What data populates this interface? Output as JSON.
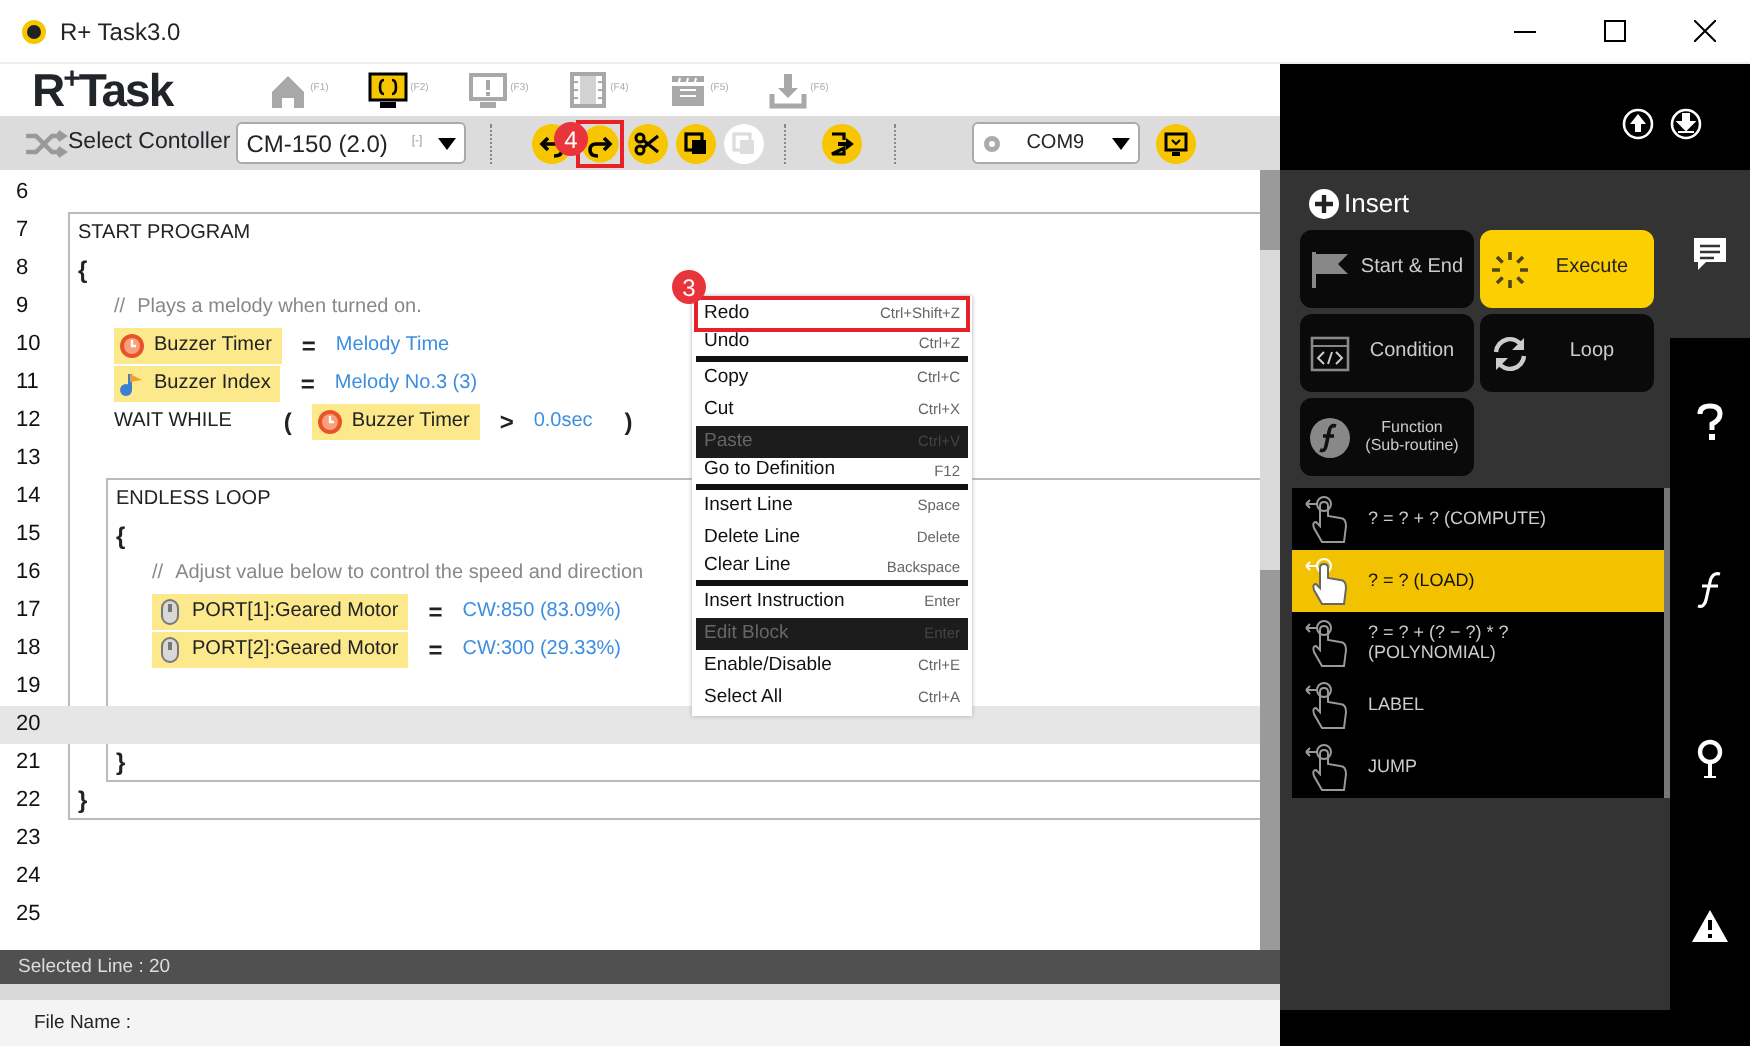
{
  "window": {
    "title": "R+ Task3.0"
  },
  "logo": "R$^{+}$Task",
  "nav": [
    {
      "kind": "home",
      "key": "(F1)",
      "selected": false
    },
    {
      "kind": "code",
      "key": "(F2)",
      "selected": true
    },
    {
      "kind": "alert",
      "key": "(F3)",
      "selected": false
    },
    {
      "kind": "film",
      "key": "(F4)",
      "selected": false
    },
    {
      "kind": "clapper",
      "key": "(F5)",
      "selected": false
    },
    {
      "kind": "download",
      "key": "(F6)",
      "selected": false
    }
  ],
  "toolbar": {
    "controller_label": "Select Contoller",
    "controller": "CM-150 (2.0)",
    "controller_hint": "[-]",
    "buttons": [
      {
        "kind": "undo",
        "disabled": false
      },
      {
        "kind": "redo",
        "disabled": false,
        "callout": "4"
      },
      {
        "kind": "cut",
        "disabled": false
      },
      {
        "kind": "copy",
        "disabled": false
      },
      {
        "kind": "paste",
        "disabled": true
      },
      {
        "kind": "exit",
        "disabled": false
      }
    ],
    "port": "COM9"
  },
  "code": [
    {
      "kind": "blank",
      "number": "6",
      "selected": false
    },
    {
      "kind": "block",
      "number": "7",
      "title": "START PROGRAM",
      "selected": false,
      "open": {
        "number": "8",
        "text": "{",
        "selected": false
      },
      "close": {
        "number": "22",
        "text": "}",
        "selected": false
      },
      "children": [
        {
          "kind": "comment",
          "number": "9",
          "marker": "//",
          "text": "Plays a melody when turned on.",
          "selected": false
        },
        {
          "kind": "assign",
          "number": "10",
          "target": {
            "kind": "clock",
            "label": "Buzzer Timer"
          },
          "operator": "=",
          "value": "Melody Time",
          "selected": false
        },
        {
          "kind": "assign",
          "number": "11",
          "target": {
            "kind": "note",
            "label": "Buzzer Index"
          },
          "operator": "=",
          "value": "Melody No.3 (3)",
          "selected": false
        },
        {
          "kind": "wait",
          "number": "12",
          "keyword": "WAIT WHILE",
          "open": "(",
          "target": {
            "kind": "clock",
            "label": "Buzzer Timer"
          },
          "operator": ">",
          "value": "0.0sec",
          "close": ")",
          "selected": false
        },
        {
          "kind": "blank",
          "number": "13",
          "selected": false
        },
        {
          "kind": "block",
          "number": "14",
          "title": "ENDLESS LOOP",
          "selected": false,
          "open": {
            "number": "15",
            "text": "{",
            "selected": false
          },
          "close": {
            "number": "21",
            "text": "}",
            "selected": false
          },
          "children": [
            {
              "kind": "comment",
              "number": "16",
              "marker": "//",
              "text": "Adjust value below to control the speed and direction",
              "selected": false
            },
            {
              "kind": "assign",
              "number": "17",
              "target": {
                "kind": "motor",
                "label": "PORT[1]:Geared Motor"
              },
              "operator": "=",
              "value": "CW:850 (83.09%)",
              "selected": false
            },
            {
              "kind": "assign",
              "number": "18",
              "target": {
                "kind": "motor",
                "label": "PORT[2]:Geared Motor"
              },
              "operator": "=",
              "value": "CW:300 (29.33%)",
              "selected": false
            },
            {
              "kind": "blank",
              "number": "19",
              "selected": false
            },
            {
              "kind": "blank",
              "number": "20",
              "selected": true
            }
          ]
        }
      ]
    },
    {
      "kind": "blank",
      "number": "23",
      "selected": false
    },
    {
      "kind": "blank",
      "number": "24",
      "selected": false
    },
    {
      "kind": "blank",
      "number": "25",
      "selected": false
    }
  ],
  "context_menu": {
    "callout": "3",
    "items": [
      {
        "label": "Redo",
        "shortcut": "Ctrl+Shift+Z",
        "disabled": false,
        "outlined": true,
        "group_end": false
      },
      {
        "label": "Undo",
        "shortcut": "Ctrl+Z",
        "disabled": false,
        "outlined": false,
        "group_end": true
      },
      {
        "label": "Copy",
        "shortcut": "Ctrl+C",
        "disabled": false,
        "outlined": false,
        "group_end": false
      },
      {
        "label": "Cut",
        "shortcut": "Ctrl+X",
        "disabled": false,
        "outlined": false,
        "group_end": false
      },
      {
        "label": "Paste",
        "shortcut": "Ctrl+V",
        "disabled": true,
        "outlined": false,
        "group_end": false
      },
      {
        "label": "Go to Definition",
        "shortcut": "F12",
        "disabled": false,
        "outlined": false,
        "group_end": true
      },
      {
        "label": "Insert Line",
        "shortcut": "Space",
        "disabled": false,
        "outlined": false,
        "group_end": false
      },
      {
        "label": "Delete Line",
        "shortcut": "Delete",
        "disabled": false,
        "outlined": false,
        "group_end": false
      },
      {
        "label": "Clear Line",
        "shortcut": "Backspace",
        "disabled": false,
        "outlined": false,
        "group_end": true
      },
      {
        "label": "Insert Instruction",
        "shortcut": "Enter",
        "disabled": false,
        "outlined": false,
        "group_end": false
      },
      {
        "label": "Edit Block",
        "shortcut": "Enter",
        "disabled": true,
        "outlined": false,
        "group_end": false
      },
      {
        "label": "Enable/Disable",
        "shortcut": "Ctrl+E",
        "disabled": false,
        "outlined": false,
        "group_end": false
      },
      {
        "label": "Select All",
        "shortcut": "Ctrl+A",
        "disabled": false,
        "outlined": false,
        "group_end": false
      }
    ]
  },
  "status_bar": "Selected Line : 20",
  "file_name_label": "File Name :",
  "insert_panel": {
    "title": "Insert",
    "categories": [
      {
        "label": "Start & End",
        "kind": "flag",
        "selected": false
      },
      {
        "label": "Execute",
        "kind": "spinner",
        "selected": true
      },
      {
        "label": "Condition",
        "kind": "window-code",
        "selected": false
      },
      {
        "label": "Loop",
        "kind": "cycle",
        "selected": false
      },
      {
        "label": "Function\n(Sub-routine)",
        "kind": "function",
        "selected": false
      }
    ],
    "instructions": [
      {
        "label": "? = ? + ?  (COMPUTE)",
        "selected": false
      },
      {
        "label": "? = ?  (LOAD)",
        "selected": true
      },
      {
        "label": "? = ? + (? − ?) * ?\n(POLYNOMIAL)",
        "selected": false
      },
      {
        "label": "LABEL",
        "selected": false
      },
      {
        "label": "JUMP",
        "selected": false
      }
    ]
  },
  "sidebar": [
    {
      "kind": "chat",
      "selected": true
    },
    {
      "kind": "question",
      "selected": false
    },
    {
      "kind": "function",
      "selected": false
    },
    {
      "kind": "pin",
      "selected": false
    },
    {
      "kind": "warning",
      "selected": false
    }
  ]
}
